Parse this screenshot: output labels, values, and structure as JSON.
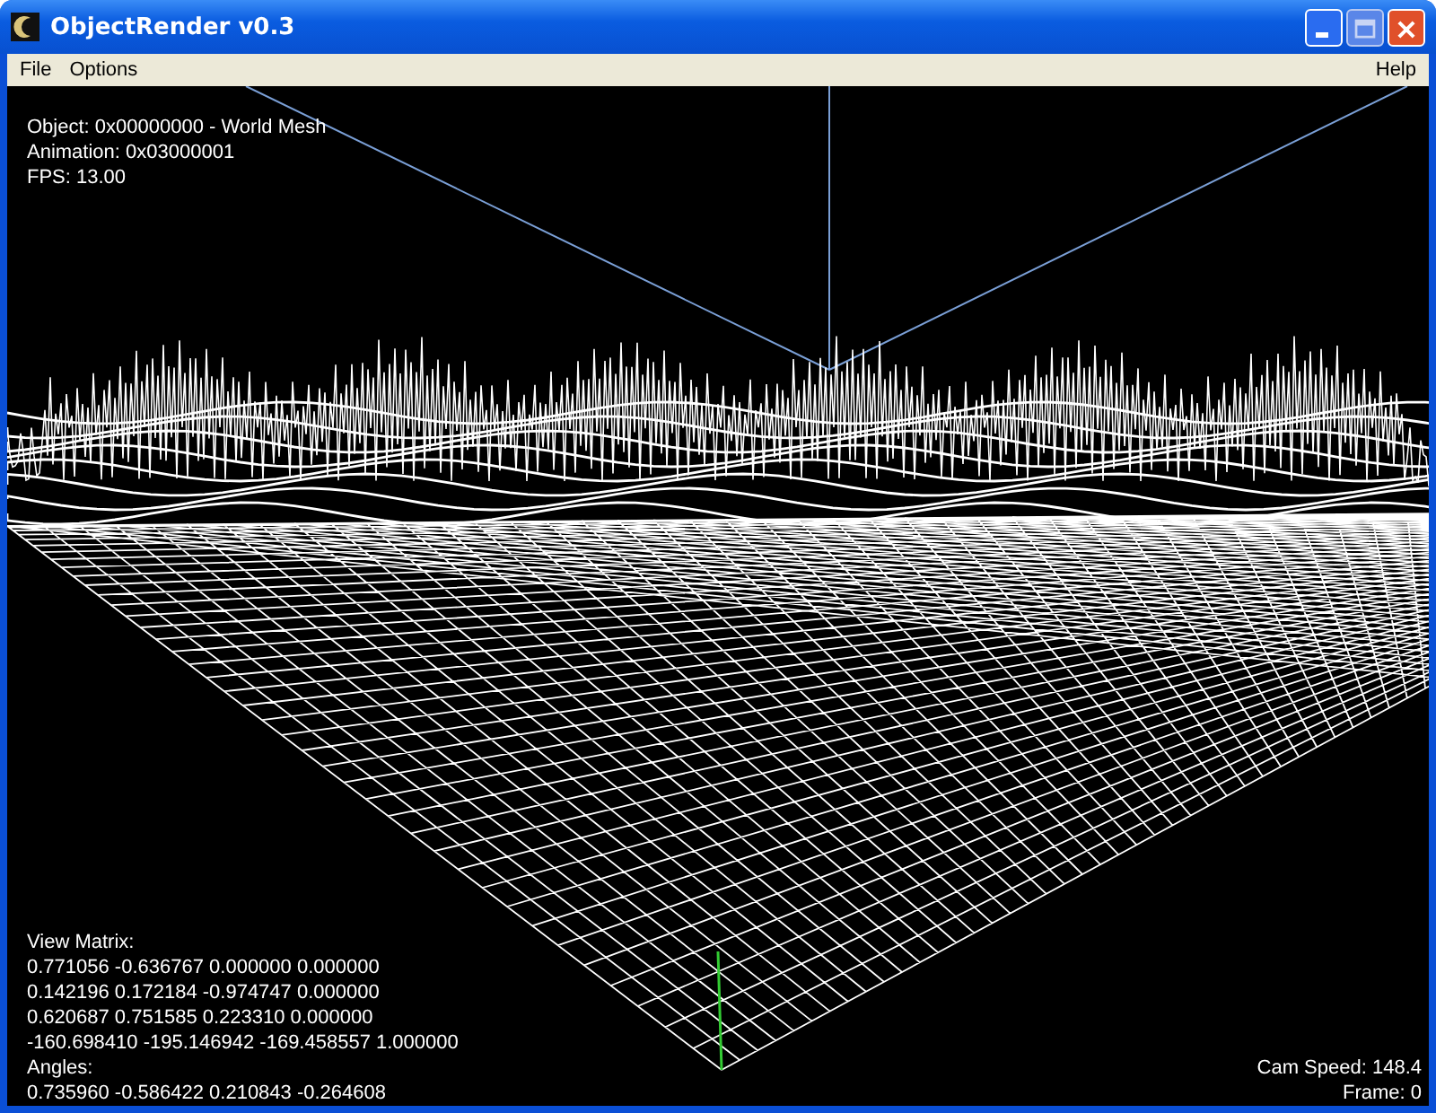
{
  "window": {
    "title": "ObjectRender v0.3"
  },
  "menu": {
    "left": [
      "File",
      "Options"
    ],
    "right": [
      "Help"
    ]
  },
  "overlay_top": [
    "Object: 0x00000000 - World Mesh",
    "Animation: 0x03000001",
    "FPS: 13.00"
  ],
  "overlay_bottom": [
    "View Matrix:",
    "0.771056 -0.636767 0.000000 0.000000",
    "0.142196 0.172184 -0.974747 0.000000",
    "0.620687 0.751585 0.223310 0.000000",
    "-160.698410 -195.146942 -169.458557 1.000000",
    "Angles:",
    "0.735960 -0.586422 0.210843 -0.264608"
  ],
  "overlay_right": [
    "Cam Speed: 148.4",
    "Frame: 0"
  ]
}
